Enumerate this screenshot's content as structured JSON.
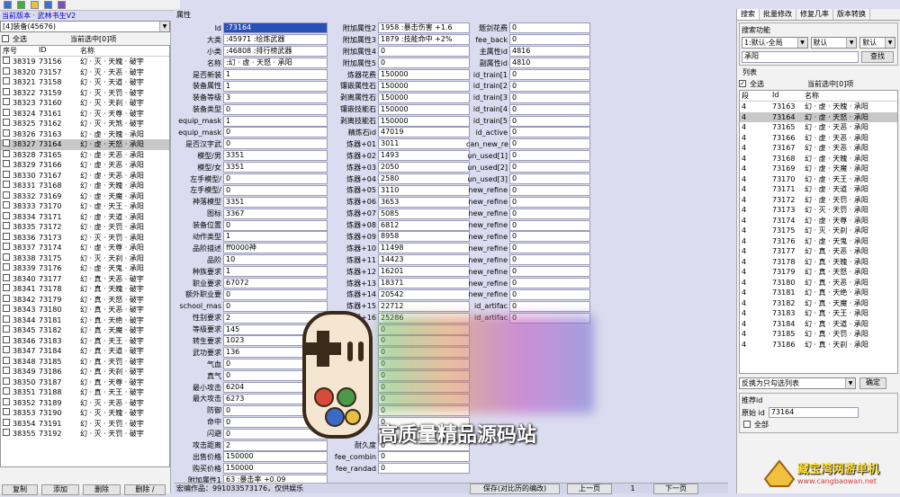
{
  "app": {
    "title": "当前版本 · 武林书生V2"
  },
  "left": {
    "filter_value": "[4]装备(45676)",
    "select_all": "全选",
    "selected_info": "当前选中[0]项",
    "columns": [
      "序号",
      "ID",
      "名称"
    ],
    "rows": [
      [
        "38319",
        "73156",
        "幻 · 灭 · 天魄 · 破宇"
      ],
      [
        "38320",
        "73157",
        "幻 · 灭 · 天恶 · 破宇"
      ],
      [
        "38321",
        "73158",
        "幻 · 灭 · 天道 · 破宇"
      ],
      [
        "38322",
        "73159",
        "幻 · 灭 · 天罚 · 破宇"
      ],
      [
        "38323",
        "73160",
        "幻 · 灭 · 天刹 · 破宇"
      ],
      [
        "38324",
        "73161",
        "幻 · 灭 · 天尊 · 破宇"
      ],
      [
        "38325",
        "73162",
        "幻 · 灭 · 天煞 · 破宇"
      ],
      [
        "38326",
        "73163",
        "幻 · 虚 · 天魄 · 承阳"
      ],
      [
        "38327",
        "73164",
        "幻 · 虚 · 天怒 · 承阳"
      ],
      [
        "38328",
        "73165",
        "幻 · 虚 · 天恶 · 承阳"
      ],
      [
        "38329",
        "73166",
        "幻 · 虚 · 天恶 · 承阳"
      ],
      [
        "38330",
        "73167",
        "幻 · 虚 · 天恶 · 承阳"
      ],
      [
        "38331",
        "73168",
        "幻 · 虚 · 天魄 · 承阳"
      ],
      [
        "38332",
        "73169",
        "幻 · 虚 · 天魔 · 承阳"
      ],
      [
        "38333",
        "73170",
        "幻 · 虚 · 天王 · 承阳"
      ],
      [
        "38334",
        "73171",
        "幻 · 虚 · 天道 · 承阳"
      ],
      [
        "38335",
        "73172",
        "幻 · 虚 · 天罚 · 承阳"
      ],
      [
        "38336",
        "73173",
        "幻 · 灭 · 天罚 · 承阳"
      ],
      [
        "38337",
        "73174",
        "幻 · 虚 · 天尊 · 承阳"
      ],
      [
        "38338",
        "73175",
        "幻 · 灭 · 天刹 · 承阳"
      ],
      [
        "38339",
        "73176",
        "幻 · 虚 · 天鬼 · 承阳"
      ],
      [
        "38340",
        "73177",
        "幻 · 真 · 天恶 · 破宇"
      ],
      [
        "38341",
        "73178",
        "幻 · 真 · 天魄 · 破宇"
      ],
      [
        "38342",
        "73179",
        "幻 · 真 · 天怒 · 破宇"
      ],
      [
        "38343",
        "73180",
        "幻 · 真 · 天恶 · 破宇"
      ],
      [
        "38344",
        "73181",
        "幻 · 真 · 天绝 · 破宇"
      ],
      [
        "38345",
        "73182",
        "幻 · 真 · 天魔 · 破宇"
      ],
      [
        "38346",
        "73183",
        "幻 · 真 · 天王 · 破宇"
      ],
      [
        "38347",
        "73184",
        "幻 · 真 · 天道 · 破宇"
      ],
      [
        "38348",
        "73185",
        "幻 · 真 · 天罚 · 破宇"
      ],
      [
        "38349",
        "73186",
        "幻 · 真 · 天刹 · 破宇"
      ],
      [
        "38350",
        "73187",
        "幻 · 真 · 天尊 · 破宇"
      ],
      [
        "38351",
        "73188",
        "幻 · 真 · 天王 · 破宇"
      ],
      [
        "38352",
        "73189",
        "幻 · 灭 · 天恶 · 破宇"
      ],
      [
        "38353",
        "73190",
        "幻 · 灭 · 天魄 · 破宇"
      ],
      [
        "38354",
        "73191",
        "幻 · 灭 · 天罚 · 破宇"
      ],
      [
        "38355",
        "73192",
        "幻 · 灭 · 天罚 · 破宇"
      ]
    ],
    "buttons": [
      "复制",
      "添加",
      "删除",
      "删除 /"
    ]
  },
  "mid": {
    "section_title": "属性",
    "col1": [
      [
        "Id",
        ":73164"
      ],
      [
        "大类",
        ":45971 :绘炼武器"
      ],
      [
        "小类",
        ":46808 :排行榜武器"
      ],
      [
        "名称",
        ":幻 · 虚 · 天怒 · 承阳"
      ],
      [
        "是否新装",
        "1"
      ],
      [
        "装备属性",
        "1"
      ],
      [
        "装备等级",
        "3"
      ],
      [
        "装备类型",
        "0"
      ],
      [
        "equip_mask",
        "1"
      ],
      [
        "equip_mask",
        "0"
      ],
      [
        "是否汉字武",
        "0"
      ],
      [
        "模型/男",
        "3351"
      ],
      [
        "模型/女",
        "3351"
      ],
      [
        "左手模型/",
        "0"
      ],
      [
        "左手模型/",
        "0"
      ],
      [
        "神落模型",
        "3351"
      ],
      [
        "图标",
        "3367"
      ],
      [
        "装备位置",
        "0"
      ],
      [
        "动作类型",
        "1"
      ],
      [
        "品阶描述",
        "  ff0000神"
      ],
      [
        "品阶",
        "10"
      ],
      [
        "种族要求",
        "1"
      ],
      [
        "职业要求",
        "67072"
      ],
      [
        "额外职业要",
        "0"
      ],
      [
        "school_mas",
        "0"
      ],
      [
        "性别要求",
        "2"
      ],
      [
        "等级要求",
        "145"
      ],
      [
        "转生要求",
        "1023"
      ],
      [
        "武功要求",
        "136"
      ],
      [
        "气血",
        "0"
      ],
      [
        "真气",
        "0"
      ],
      [
        "最小攻击",
        "6204"
      ],
      [
        "最大攻击",
        "6273"
      ],
      [
        "防御",
        "0"
      ],
      [
        "命中",
        "0"
      ],
      [
        "闪避",
        "0"
      ],
      [
        "攻击距离",
        "2"
      ],
      [
        "出售价格",
        "150000"
      ],
      [
        "购买价格",
        "150000"
      ],
      [
        "附加属性1",
        "63 :暴击率 +0.09"
      ]
    ],
    "col2": [
      [
        "附加属性2",
        "1958 :暴击伤害 +1.6"
      ],
      [
        "附加属性3",
        "1879 :技能命中 +2%"
      ],
      [
        "附加属性4",
        "0"
      ],
      [
        "附加属性5",
        "0"
      ],
      [
        "炼器花费",
        "150000"
      ],
      [
        "镶嵌属性石",
        "150000"
      ],
      [
        "剥离属性石",
        "150000"
      ],
      [
        "镶嵌技能石",
        "150000"
      ],
      [
        "剥离技能石",
        "150000"
      ],
      [
        "精炼石id",
        "47019"
      ],
      [
        "炼器+01",
        "3011"
      ],
      [
        "炼器+02",
        "1493"
      ],
      [
        "炼器+03",
        "2050"
      ],
      [
        "炼器+04",
        "2580"
      ],
      [
        "炼器+05",
        "3110"
      ],
      [
        "炼器+06",
        "3653"
      ],
      [
        "炼器+07",
        "5085"
      ],
      [
        "炼器+08",
        "6812"
      ],
      [
        "炼器+09",
        "8958"
      ],
      [
        "炼器+10",
        "11498"
      ],
      [
        "炼器+11",
        "14423"
      ],
      [
        "炼器+12",
        "16201"
      ],
      [
        "炼器+13",
        "18371"
      ],
      [
        "炼器+14",
        "20542"
      ],
      [
        "炼器+15",
        "22712"
      ],
      [
        "炼器+16",
        "25286"
      ],
      [
        "",
        "0"
      ],
      [
        "",
        "0"
      ],
      [
        "",
        "0"
      ],
      [
        "",
        "0"
      ],
      [
        "",
        "0"
      ],
      [
        "",
        "0"
      ],
      [
        "",
        "0"
      ],
      [
        "",
        "0"
      ],
      [
        "",
        "0"
      ],
      [
        "",
        "0"
      ],
      [
        "耐久度",
        "0"
      ],
      [
        "fee_combin",
        "0"
      ],
      [
        "fee_randad",
        "0"
      ]
    ],
    "col3": [
      [
        "题剑花费",
        "0"
      ],
      [
        "fee_back",
        "0"
      ],
      [
        "主属性id",
        "4816"
      ],
      [
        "副属性id",
        "4810"
      ],
      [
        "id_train[1",
        "0"
      ],
      [
        "id_train[2",
        "0"
      ],
      [
        "id_train[3",
        "0"
      ],
      [
        "id_train[4",
        "0"
      ],
      [
        "id_train[5",
        "0"
      ],
      [
        "id_active",
        "0"
      ],
      [
        "can_new_re",
        "0"
      ],
      [
        "un_used[1]",
        "0"
      ],
      [
        "un_used[2]",
        "0"
      ],
      [
        "un_used[3]",
        "0"
      ],
      [
        "new_refine",
        "0"
      ],
      [
        "new_refine",
        "0"
      ],
      [
        "new_refine",
        "0"
      ],
      [
        "new_refine",
        "0"
      ],
      [
        "new_refine",
        "0"
      ],
      [
        "new_refine",
        "0"
      ],
      [
        "new_refine",
        "0"
      ],
      [
        "new_refine",
        "0"
      ],
      [
        "new_refine",
        "0"
      ],
      [
        "new_refine",
        "0"
      ],
      [
        "id_artifac",
        "0"
      ],
      [
        "id_artifac",
        "0"
      ]
    ],
    "status_text": "宏编作品：991033573176，仅供娱乐",
    "save_btn": "保存(对比历的编改)",
    "prev_btn": "上一页",
    "page": "1",
    "next_btn": "下一页"
  },
  "overlay": {
    "text": "高质量精品源码站"
  },
  "right": {
    "tabs": [
      "搜索",
      "批量修改",
      "修复几率",
      "版本转换"
    ],
    "search_group": "搜索功能",
    "mode": "1:默认-全局",
    "mode2": "默认",
    "mode3": "默认",
    "keyword": "承阳",
    "search_btn": "查找",
    "list_title": "列表",
    "select_all": "全选",
    "selected_info": "当前选中[0]项",
    "columns": [
      "段",
      "Id",
      "名称"
    ],
    "rows": [
      [
        "4",
        "73163",
        "幻 · 虚 · 天魄 · 承阳"
      ],
      [
        "4",
        "73164",
        "幻 · 虚 · 天怒 · 承阳"
      ],
      [
        "4",
        "73165",
        "幻 · 虚 · 天恶 · 承阳"
      ],
      [
        "4",
        "73166",
        "幻 · 虚 · 天恶 · 承阳"
      ],
      [
        "4",
        "73167",
        "幻 · 虚 · 天恶 · 承阳"
      ],
      [
        "4",
        "73168",
        "幻 · 虚 · 天魄 · 承阳"
      ],
      [
        "4",
        "73169",
        "幻 · 虚 · 天魔 · 承阳"
      ],
      [
        "4",
        "73170",
        "幻 · 虚 · 天王 · 承阳"
      ],
      [
        "4",
        "73171",
        "幻 · 虚 · 天道 · 承阳"
      ],
      [
        "4",
        "73172",
        "幻 · 虚 · 天罚 · 承阳"
      ],
      [
        "4",
        "73173",
        "幻 · 灭 · 天罚 · 承阳"
      ],
      [
        "4",
        "73174",
        "幻 · 虚 · 天尊 · 承阳"
      ],
      [
        "4",
        "73175",
        "幻 · 灭 · 天刹 · 承阳"
      ],
      [
        "4",
        "73176",
        "幻 · 虚 · 天鬼 · 承阳"
      ],
      [
        "4",
        "73177",
        "幻 · 真 · 天恶 · 承阳"
      ],
      [
        "4",
        "73178",
        "幻 · 真 · 天魄 · 承阳"
      ],
      [
        "4",
        "73179",
        "幻 · 真 · 天怒 · 承阳"
      ],
      [
        "4",
        "73180",
        "幻 · 真 · 天恶 · 承阳"
      ],
      [
        "4",
        "73181",
        "幻 · 真 · 天绝 · 承阳"
      ],
      [
        "4",
        "73182",
        "幻 · 真 · 天魔 · 承阳"
      ],
      [
        "4",
        "73183",
        "幻 · 真 · 天王 · 承阳"
      ],
      [
        "4",
        "73184",
        "幻 · 真 · 天道 · 承阳"
      ],
      [
        "4",
        "73185",
        "幻 · 真 · 天罚 · 承阳"
      ],
      [
        "4",
        "73186",
        "幻 · 真 · 天刹 · 承阳"
      ]
    ],
    "action": "反携为只勾选列表",
    "confirm_btn": "确定",
    "recommend_title": "推荐id",
    "orig_label": "原始 id",
    "orig_value": "73164",
    "all_label": "全部"
  },
  "watermark": {
    "line1": "藏宝湾网游单机",
    "line2": "www.cangbaowan.net"
  }
}
